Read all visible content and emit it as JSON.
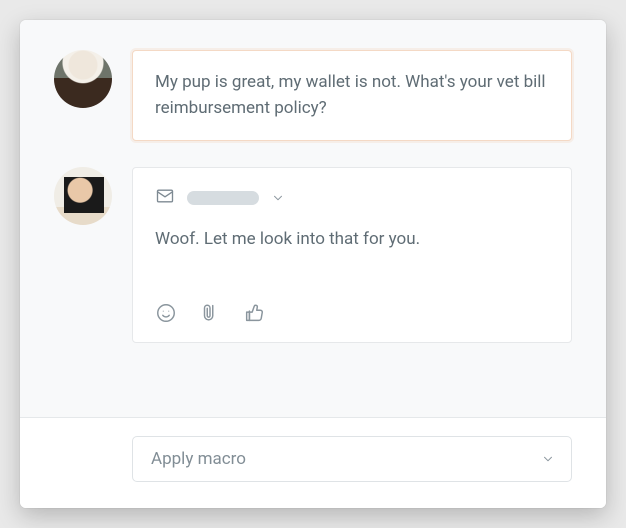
{
  "customer": {
    "message": "My pup is great, my wallet is not. What's your vet bill reimbursement policy?"
  },
  "reply": {
    "channel_icon": "mail",
    "body": "Woof. Let me look into that for you."
  },
  "footer": {
    "macro_placeholder": "Apply macro"
  },
  "icons": {
    "mail": "mail-icon",
    "chevron_down": "chevron-down-icon",
    "emoji": "emoji-icon",
    "attachment": "attachment-icon",
    "thumbs_up": "thumbs-up-icon"
  }
}
